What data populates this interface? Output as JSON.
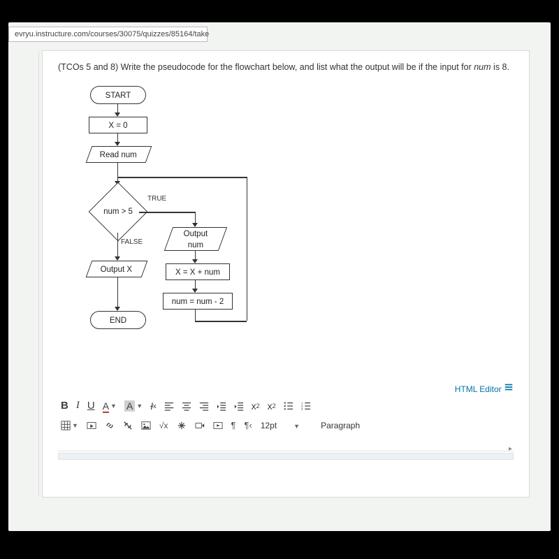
{
  "url": "evryu.instructure.com/courses/30075/quizzes/85164/take",
  "question": {
    "prefix": "(TCOs 5 and 8) Write the pseudocode for the flowchart below, and list what the output will be if the input for ",
    "var": "num",
    "suffix": " is 8."
  },
  "flowchart": {
    "start": "START",
    "init": "X = 0",
    "read": "Read num",
    "decision": "num > 5",
    "true_label": "TRUE",
    "false_label": "FALSE",
    "out_num": "Output\nnum",
    "accum": "X = X + num",
    "dec": "num = num - 2",
    "out_x": "Output X",
    "end": "END"
  },
  "editor": {
    "html_editor": "HTML Editor",
    "fontsize": "12pt",
    "paragraph": "Paragraph"
  }
}
